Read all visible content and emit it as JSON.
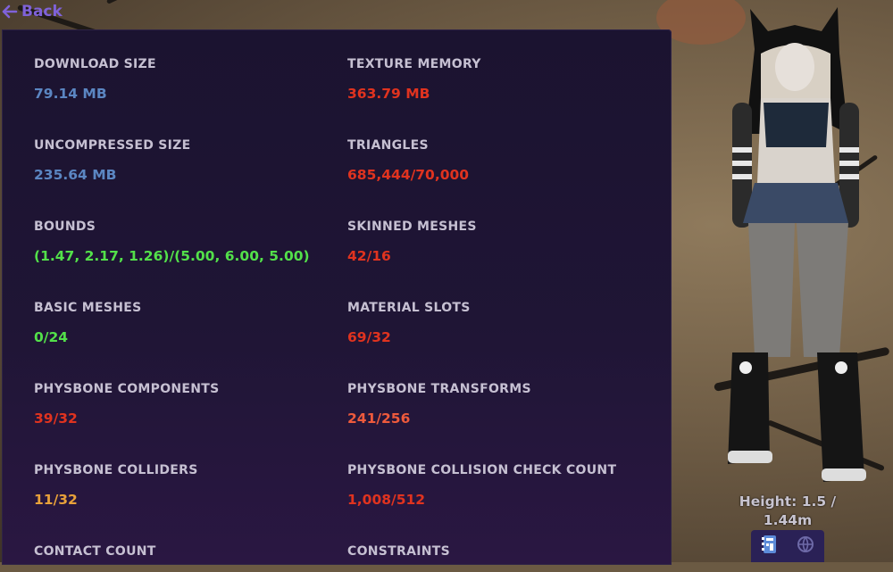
{
  "nav": {
    "back_label": "Back"
  },
  "colors": {
    "label": "#c6c0d2",
    "neutral_blue": "#5b86c2",
    "good_green": "#53e04a",
    "warn_orange": "#e8a13a",
    "bad_red": "#e0331f",
    "accent_purple": "#7f62d9"
  },
  "stats": [
    {
      "label": "Download Size",
      "value": "79.14 MB",
      "status": "neutral"
    },
    {
      "label": "Texture Memory",
      "value": "363.79 MB",
      "status": "bad"
    },
    {
      "label": "Uncompressed Size",
      "value": "235.64 MB",
      "status": "neutral"
    },
    {
      "label": "Triangles",
      "value": "685,444/70,000",
      "status": "bad"
    },
    {
      "label": "Bounds",
      "value": "(1.47, 2.17, 1.26)/(5.00, 6.00, 5.00)",
      "status": "good"
    },
    {
      "label": "Skinned Meshes",
      "value": "42/16",
      "status": "bad"
    },
    {
      "label": "Basic Meshes",
      "value": "0/24",
      "status": "good"
    },
    {
      "label": "Material Slots",
      "value": "69/32",
      "status": "bad"
    },
    {
      "label": "PhysBone Components",
      "value": "39/32",
      "status": "bad"
    },
    {
      "label": "PhysBone Transforms",
      "value": "241/256",
      "status": "bad-light"
    },
    {
      "label": "PhysBone Colliders",
      "value": "11/32",
      "status": "warn"
    },
    {
      "label": "PhysBone Collision Check Count",
      "value": "1,008/512",
      "status": "bad"
    },
    {
      "label": "Contact Count",
      "value": "",
      "status": "neutral"
    },
    {
      "label": "Constraints",
      "value": "",
      "status": "neutral"
    }
  ],
  "avatar": {
    "height_text_line1": "Height: 1.5 /",
    "height_text_line2": "1.44m"
  },
  "toolbar": {
    "icons": [
      "performance-book-icon",
      "globe-icon"
    ]
  }
}
